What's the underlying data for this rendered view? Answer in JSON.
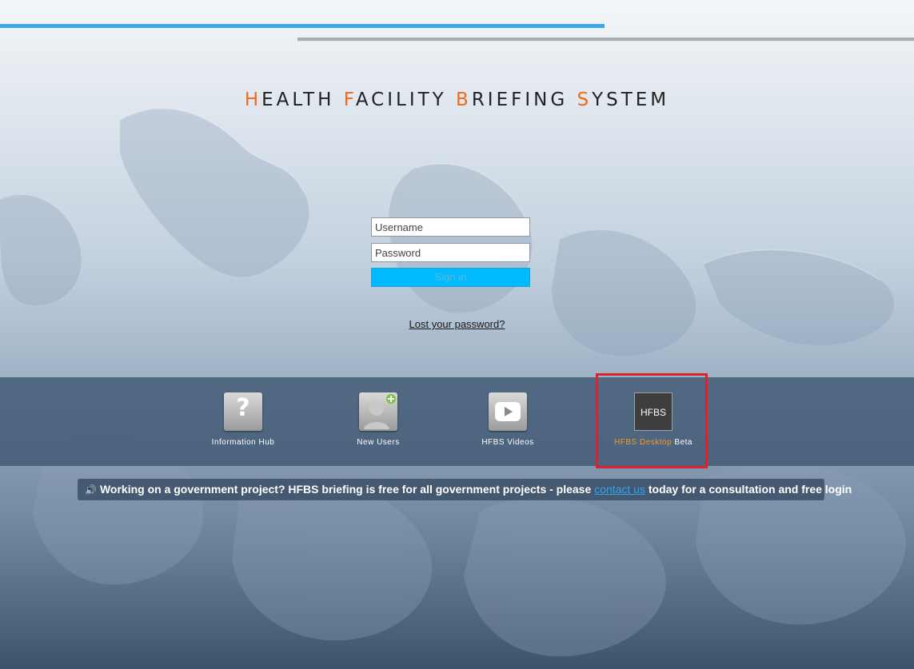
{
  "title": {
    "words": [
      {
        "initial": "H",
        "rest": "EALTH"
      },
      {
        "initial": "F",
        "rest": "ACILITY"
      },
      {
        "initial": "B",
        "rest": "RIEFING"
      },
      {
        "initial": "S",
        "rest": "YSTEM"
      }
    ]
  },
  "login": {
    "username_placeholder": "Username",
    "password_placeholder": "Password",
    "signin_label": "Sign in",
    "lost_password": "Lost your password?"
  },
  "tiles": {
    "info_hub": {
      "label": "Information Hub",
      "icon": "question-icon"
    },
    "new_users": {
      "label": "New Users",
      "icon": "new-user-icon"
    },
    "videos": {
      "label": "HFBS Videos",
      "icon": "play-icon"
    },
    "desktop": {
      "icon_text": "HFBS",
      "label_accent": "HFBS Desktop",
      "label_rest": "Beta",
      "icon": "hfbs-desktop-icon"
    }
  },
  "notice": {
    "icon": "speaker-icon",
    "text_before": "Working on a government project? HFBS briefing is free for all government projects - please",
    "link": "contact us",
    "text_after": "today for a consultation and free login"
  },
  "colors": {
    "accent_orange": "#ef6a1a",
    "signin_blue": "#00b9ff",
    "highlight_red": "#e0202a",
    "top_bar_blue": "#3aa7ea"
  }
}
